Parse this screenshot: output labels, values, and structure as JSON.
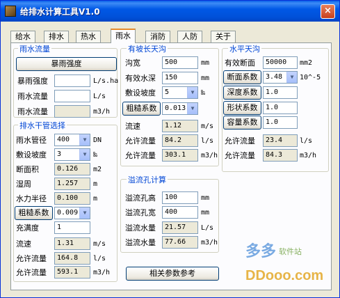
{
  "window": {
    "title": "给排水计算工具V1.0",
    "close": "×"
  },
  "tabs": [
    "给水",
    "排水",
    "热水",
    "雨水",
    "消防",
    "人防",
    "关于"
  ],
  "storm_flow": {
    "title": "雨水流量",
    "button": "暴雨强度",
    "rows": [
      {
        "label": "暴雨强度",
        "value": "",
        "unit": "L/s.ha"
      },
      {
        "label": "雨水流量",
        "value": "",
        "unit": "L/s"
      },
      {
        "label": "雨水流量",
        "value": "",
        "unit": "m3/h"
      }
    ]
  },
  "main_pipe": {
    "title": "排水干管选择",
    "diameter": {
      "label": "雨水管径",
      "value": "400",
      "unit": "DN"
    },
    "slope": {
      "label": "敷设坡度",
      "value": "3",
      "unit": "‰"
    },
    "area": {
      "label": "断面积",
      "value": "0.126",
      "unit": "m2"
    },
    "perimeter": {
      "label": "湿周",
      "value": "1.257",
      "unit": "m"
    },
    "radius": {
      "label": "水力半径",
      "value": "0.100",
      "unit": "m"
    },
    "roughness": {
      "label": "粗糙系数",
      "value": "0.009"
    },
    "fullness": {
      "label": "充满度",
      "value": "1"
    },
    "velocity": {
      "label": "流速",
      "value": "1.31",
      "unit": "m/s"
    },
    "flow_ls": {
      "label": "允许流量",
      "value": "164.8",
      "unit": "l/s"
    },
    "flow_m3h": {
      "label": "允许流量",
      "value": "593.1",
      "unit": "m3/h"
    }
  },
  "slope_gutter": {
    "title": "有坡长天沟",
    "width": {
      "label": "沟宽",
      "value": "500",
      "unit": "mm"
    },
    "depth": {
      "label": "有效水深",
      "value": "150",
      "unit": "mm"
    },
    "slope": {
      "label": "敷设坡度",
      "value": "5",
      "unit": "‰"
    },
    "roughness": {
      "label": "粗糙系数",
      "value": "0.013"
    },
    "velocity": {
      "label": "流速",
      "value": "1.12",
      "unit": "m/s"
    },
    "flow_ls": {
      "label": "允许流量",
      "value": "84.2",
      "unit": "l/s"
    },
    "flow_m3h": {
      "label": "允许流量",
      "value": "303.1",
      "unit": "m3/h"
    }
  },
  "overflow": {
    "title": "溢流孔计算",
    "height": {
      "label": "溢流孔高",
      "value": "100",
      "unit": "mm"
    },
    "width": {
      "label": "溢流孔宽",
      "value": "400",
      "unit": "mm"
    },
    "flow_ls": {
      "label": "溢流水量",
      "value": "21.57",
      "unit": "L/s"
    },
    "flow_m3h": {
      "label": "溢流水量",
      "value": "77.66",
      "unit": "m3/h"
    }
  },
  "flat_gutter": {
    "title": "水平天沟",
    "section": {
      "label": "有效断面",
      "value": "50000",
      "unit": "mm2"
    },
    "section_coef": {
      "label": "断面系数",
      "value": "3.48",
      "unit": "10^-5"
    },
    "depth_coef": {
      "label": "深度系数",
      "value": "1.0"
    },
    "shape_coef": {
      "label": "形状系数",
      "value": "1.0"
    },
    "capacity_coef": {
      "label": "容量系数",
      "value": "1.0"
    },
    "flow_ls": {
      "label": "允许流量",
      "value": "23.4",
      "unit": "l/s"
    },
    "flow_m3h": {
      "label": "允许流量",
      "value": "84.3",
      "unit": "m3/h"
    }
  },
  "ref_button": "相关参数参考",
  "watermark": {
    "logo": "多多",
    "tag": "软件站",
    "site": "DDooo.com"
  },
  "colors": {
    "titlebar": "#0054e3",
    "group_title": "#0046d5",
    "tab_highlight": "#e68b2c"
  }
}
